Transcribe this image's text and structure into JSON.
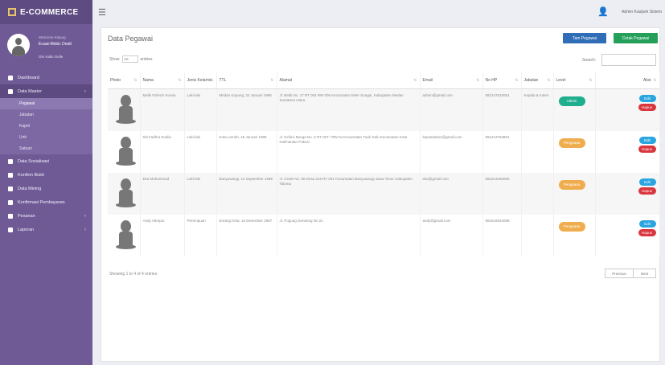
{
  "brand": {
    "name": "E-COMMERCE"
  },
  "profile": {
    "welcome": "Welcome Kalyug",
    "name": "Ecaat-Mobic Dealt",
    "status": "Om Kalin Gelle"
  },
  "nav": [
    {
      "label": "Dashboard",
      "active": false
    },
    {
      "label": "Data Master",
      "active": true,
      "arrow": "‹"
    },
    {
      "label": "Data Sosialisasi",
      "active": false
    },
    {
      "label": "Konfirm Bukti",
      "active": false
    },
    {
      "label": "Data Mining",
      "active": false
    },
    {
      "label": "Konfirmasi Pembayaran",
      "active": false
    },
    {
      "label": "Pesanan",
      "active": false,
      "arrow": "‹"
    },
    {
      "label": "Laporan",
      "active": false,
      "arrow": "‹"
    }
  ],
  "submenu": [
    "Pegawai",
    "Jabatan",
    "Kaprit",
    "Unit",
    "Satuan"
  ],
  "topbar": {
    "user": "Admin Kasipek Sistem"
  },
  "panel": {
    "title": "Data Pegawai",
    "add_label": "Tam Pegawai",
    "print_label": "Cetak Pegawai",
    "show_label": "Show",
    "show_value": "10",
    "entries_label": "entries",
    "search_label": "Search:"
  },
  "table": {
    "headers": [
      "Photo",
      "Nama",
      "Jenis Kelamin",
      "TTL",
      "Alamat",
      "Email",
      "No HP",
      "Jabatan",
      "Level",
      "Aksi"
    ],
    "rows": [
      {
        "nama": "Malik Fahrezi Kurnia",
        "jk": "Laki-laki",
        "ttl": "Medan Kopung, 22 Januari 1988",
        "alamat": "Jl. Betik No. 17 RT 004 RW 005 Kecamatan Deler Sungai, Kabupaten Medan Sumatera Utara",
        "email": "admin@gmail.com",
        "hp": "082147510051",
        "jabatan": "Kepala & Intern",
        "level": "Admin",
        "level_color": "#1fae8e"
      },
      {
        "nama": "Siti Fadhra Evelia",
        "jk": "Laki-laki",
        "ttl": "Kota Lemah, 18 Januari 1998",
        "alamat": "Jl. Kelinci Bunga No. 6 RT 007 / RW 04 Kecamatan Tuah Kalu Kecamatan Kota Kalimantan Pakusi",
        "email": "kepsanitas1@gmail.com",
        "hp": "081213753801",
        "jabatan": "",
        "level": "Penguasa",
        "level_color": "#f0ad4e"
      },
      {
        "nama": "Eka Muhammad",
        "jk": "Laki-laki",
        "ttl": "Banyuwangi, 14 September 1989",
        "alamat": "Jl. Cinde No. 06 Desa 215 RT 001 Kecamatan Banyuwangi Jawa Timur Kabupaten Taluma",
        "email": "eka@gmail.com",
        "hp": "081613426005",
        "jabatan": "",
        "level": "Penguasa",
        "level_color": "#f0ad4e"
      },
      {
        "nama": "Andy Abrepto",
        "jk": "Perempuan",
        "ttl": "Enrang Keta, 16 Desember 1987",
        "alamat": "Jl. Pogung Gendong No 21",
        "email": "andy@gmail.com",
        "hp": "081519024088",
        "jabatan": "",
        "level": "Penguasa",
        "level_color": "#f0ad4e"
      }
    ],
    "edit_label": "Edit",
    "delete_label": "Hapus"
  },
  "footer": {
    "info": "Showing 1 to 4 of 4 entries",
    "prev": "Previous",
    "next": "Next"
  }
}
